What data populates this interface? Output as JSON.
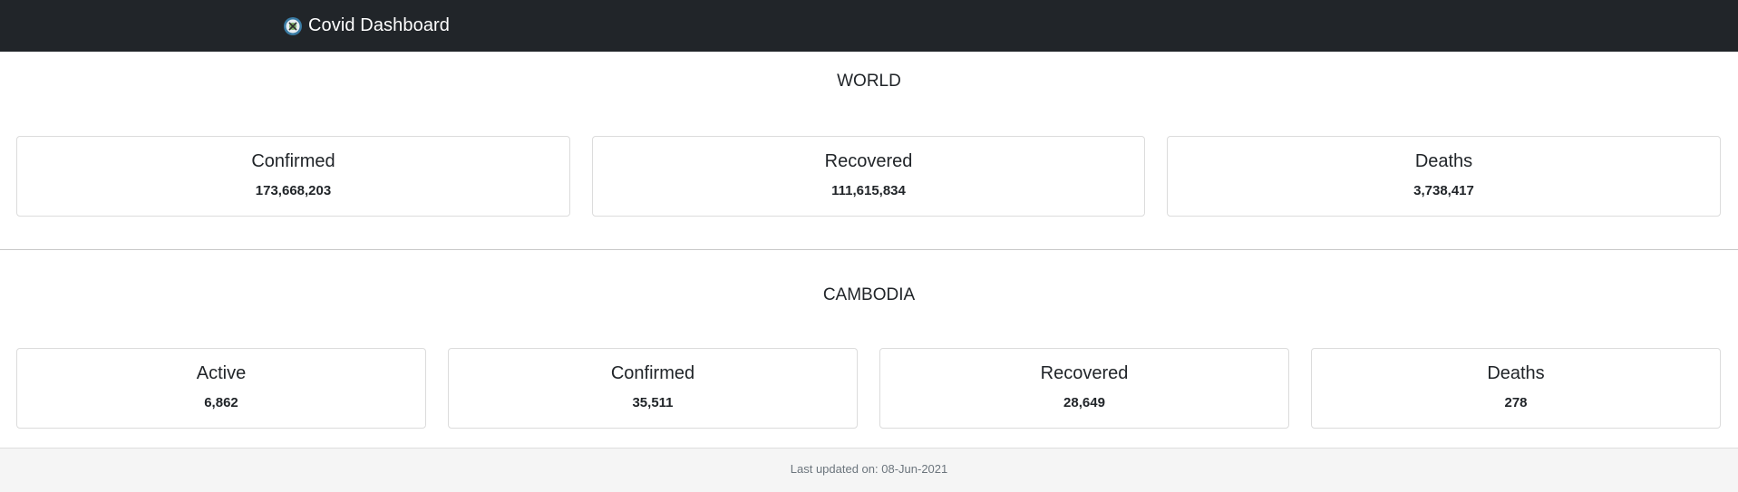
{
  "navbar": {
    "brand": "Covid Dashboard",
    "icon": "covid-logo-icon",
    "background": "#212529"
  },
  "world": {
    "title": "WORLD",
    "cards": [
      {
        "label": "Confirmed",
        "value": "173,668,203"
      },
      {
        "label": "Recovered",
        "value": "111,615,834"
      },
      {
        "label": "Deaths",
        "value": "3,738,417"
      }
    ]
  },
  "cambodia": {
    "title": "CAMBODIA",
    "cards": [
      {
        "label": "Active",
        "value": "6,862"
      },
      {
        "label": "Confirmed",
        "value": "35,511"
      },
      {
        "label": "Recovered",
        "value": "28,649"
      },
      {
        "label": "Deaths",
        "value": "278"
      }
    ]
  },
  "footer": {
    "text": "Last updated on: 08-Jun-2021"
  }
}
